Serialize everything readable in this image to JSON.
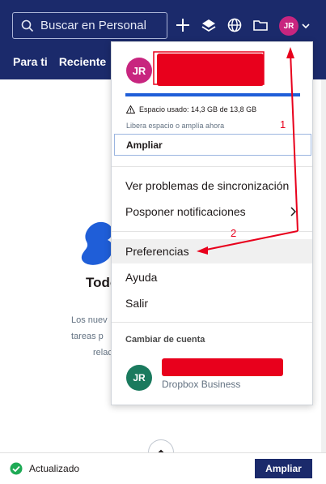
{
  "header": {
    "search_placeholder": "Buscar en Personal",
    "avatar_initials": "JR",
    "tabs": [
      "Para ti",
      "Reciente"
    ]
  },
  "background": {
    "title_partial": "Todo",
    "text_lines": [
      "Los nuev",
      "tareas p",
      "relac"
    ]
  },
  "status": {
    "text": "Actualizado",
    "upgrade_label": "Ampliar"
  },
  "menu": {
    "avatar_initials": "JR",
    "storage_text": "Espacio usado: 14,3 GB de 13,8 GB",
    "storage_hint": "Libera espacio o amplía ahora",
    "upgrade_label": "Ampliar",
    "items": [
      "Ver problemas de sincronización",
      "Posponer notificaciones",
      "Preferencias",
      "Ayuda",
      "Salir"
    ],
    "switch_account_label": "Cambiar de cuenta",
    "account_initials": "JR",
    "account_type": "Dropbox Business"
  },
  "annotations": [
    "1",
    "2"
  ],
  "colors": {
    "header_bg": "#1b2a6b",
    "avatar_pink": "#c8257f",
    "avatar_green": "#1a7a5e",
    "storage_bar": "#1f5ed8",
    "annotation_red": "#e8001c"
  }
}
